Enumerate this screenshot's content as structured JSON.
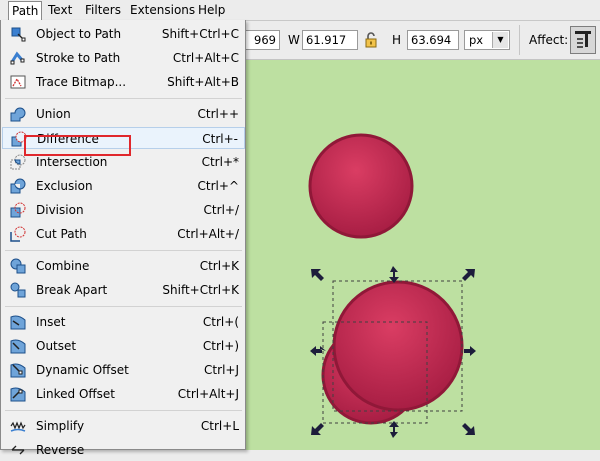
{
  "menubar": {
    "items": [
      {
        "label": "Path",
        "active": true
      },
      {
        "label": "Text"
      },
      {
        "label": "Filters"
      },
      {
        "label": "Extensions"
      },
      {
        "label": "Help"
      }
    ]
  },
  "toolbar": {
    "x_value": "969",
    "w_label": "W",
    "w_value": "61.917",
    "h_label": "H",
    "h_value": "63.694",
    "unit": "px",
    "affect_label": "Affect:"
  },
  "path_menu": {
    "items": [
      {
        "label": "Object to Path",
        "shortcut": "Shift+Ctrl+C",
        "icon": "object-to-path-icon"
      },
      {
        "label": "Stroke to Path",
        "shortcut": "Ctrl+Alt+C",
        "icon": "stroke-to-path-icon"
      },
      {
        "label": "Trace Bitmap...",
        "shortcut": "Shift+Alt+B",
        "icon": "trace-bitmap-icon"
      },
      {
        "label": "Union",
        "shortcut": "Ctrl++",
        "icon": "union-icon"
      },
      {
        "label": "Difference",
        "shortcut": "Ctrl+-",
        "icon": "difference-icon",
        "highlighted": true
      },
      {
        "label": "Intersection",
        "shortcut": "Ctrl+*",
        "icon": "intersection-icon"
      },
      {
        "label": "Exclusion",
        "shortcut": "Ctrl+^",
        "icon": "exclusion-icon"
      },
      {
        "label": "Division",
        "shortcut": "Ctrl+/",
        "icon": "division-icon"
      },
      {
        "label": "Cut Path",
        "shortcut": "Ctrl+Alt+/",
        "icon": "cut-path-icon"
      },
      {
        "label": "Combine",
        "shortcut": "Ctrl+K",
        "icon": "combine-icon"
      },
      {
        "label": "Break Apart",
        "shortcut": "Shift+Ctrl+K",
        "icon": "break-apart-icon"
      },
      {
        "label": "Inset",
        "shortcut": "Ctrl+(",
        "icon": "inset-icon"
      },
      {
        "label": "Outset",
        "shortcut": "Ctrl+)",
        "icon": "outset-icon"
      },
      {
        "label": "Dynamic Offset",
        "shortcut": "Ctrl+J",
        "icon": "dynamic-offset-icon"
      },
      {
        "label": "Linked Offset",
        "shortcut": "Ctrl+Alt+J",
        "icon": "linked-offset-icon"
      },
      {
        "label": "Simplify",
        "shortcut": "Ctrl+L",
        "icon": "simplify-icon"
      },
      {
        "label": "Reverse",
        "shortcut": "",
        "icon": "reverse-icon"
      }
    ]
  },
  "colors": {
    "canvas": "#bde0a1",
    "circle_fill": "#c52c55",
    "highlight_box": "#e0272c"
  }
}
